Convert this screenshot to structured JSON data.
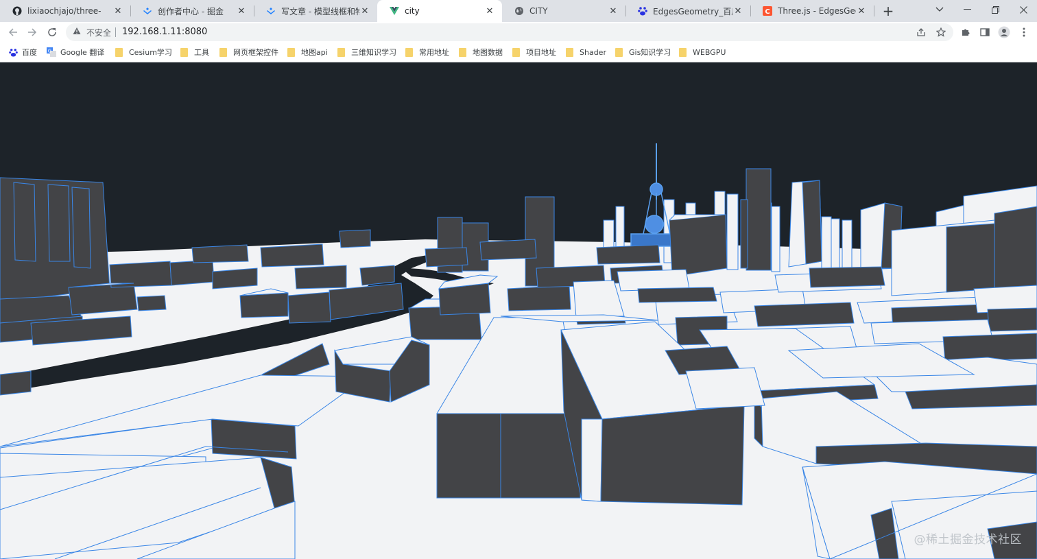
{
  "tabs": [
    {
      "title": "lixiaochjajo/three-",
      "icon": "github-icon",
      "active": false
    },
    {
      "title": "创作者中心 - 掘金",
      "icon": "juejin-icon",
      "active": false
    },
    {
      "title": "写文章 - 模型线框和物理",
      "icon": "juejin-icon",
      "active": false
    },
    {
      "title": "city",
      "icon": "vue-icon",
      "active": true
    },
    {
      "title": "CITY",
      "icon": "globe-icon",
      "active": false
    },
    {
      "title": "EdgesGeometry_百度搜",
      "icon": "baidu-icon",
      "active": false
    },
    {
      "title": "Three.js - EdgesGeomet",
      "icon": "c-logo-icon",
      "active": false
    }
  ],
  "omnibox": {
    "security_label": "不安全",
    "url": "192.168.1.11:8080"
  },
  "bookmarks": [
    {
      "label": "百度",
      "icon": "baidu-icon"
    },
    {
      "label": "Google 翻译",
      "icon": "translate-icon"
    },
    {
      "label": "Cesium学习",
      "icon": "folder-icon"
    },
    {
      "label": "工具",
      "icon": "folder-icon"
    },
    {
      "label": "网页框架控件",
      "icon": "folder-icon"
    },
    {
      "label": "地图api",
      "icon": "folder-icon"
    },
    {
      "label": "三维知识学习",
      "icon": "folder-icon"
    },
    {
      "label": "常用地址",
      "icon": "folder-icon"
    },
    {
      "label": "地图数据",
      "icon": "folder-icon"
    },
    {
      "label": "项目地址",
      "icon": "folder-icon"
    },
    {
      "label": "Shader",
      "icon": "folder-icon"
    },
    {
      "label": "Gis知识学习",
      "icon": "folder-icon"
    },
    {
      "label": "WEBGPU",
      "icon": "folder-icon"
    }
  ],
  "watermark": "@稀土掘金技术社区",
  "colors": {
    "sky": "#1d2329",
    "building_top": "#f2f3f5",
    "building_side": "#434447",
    "edge": "#3a86e6",
    "river": "#1d2329"
  }
}
